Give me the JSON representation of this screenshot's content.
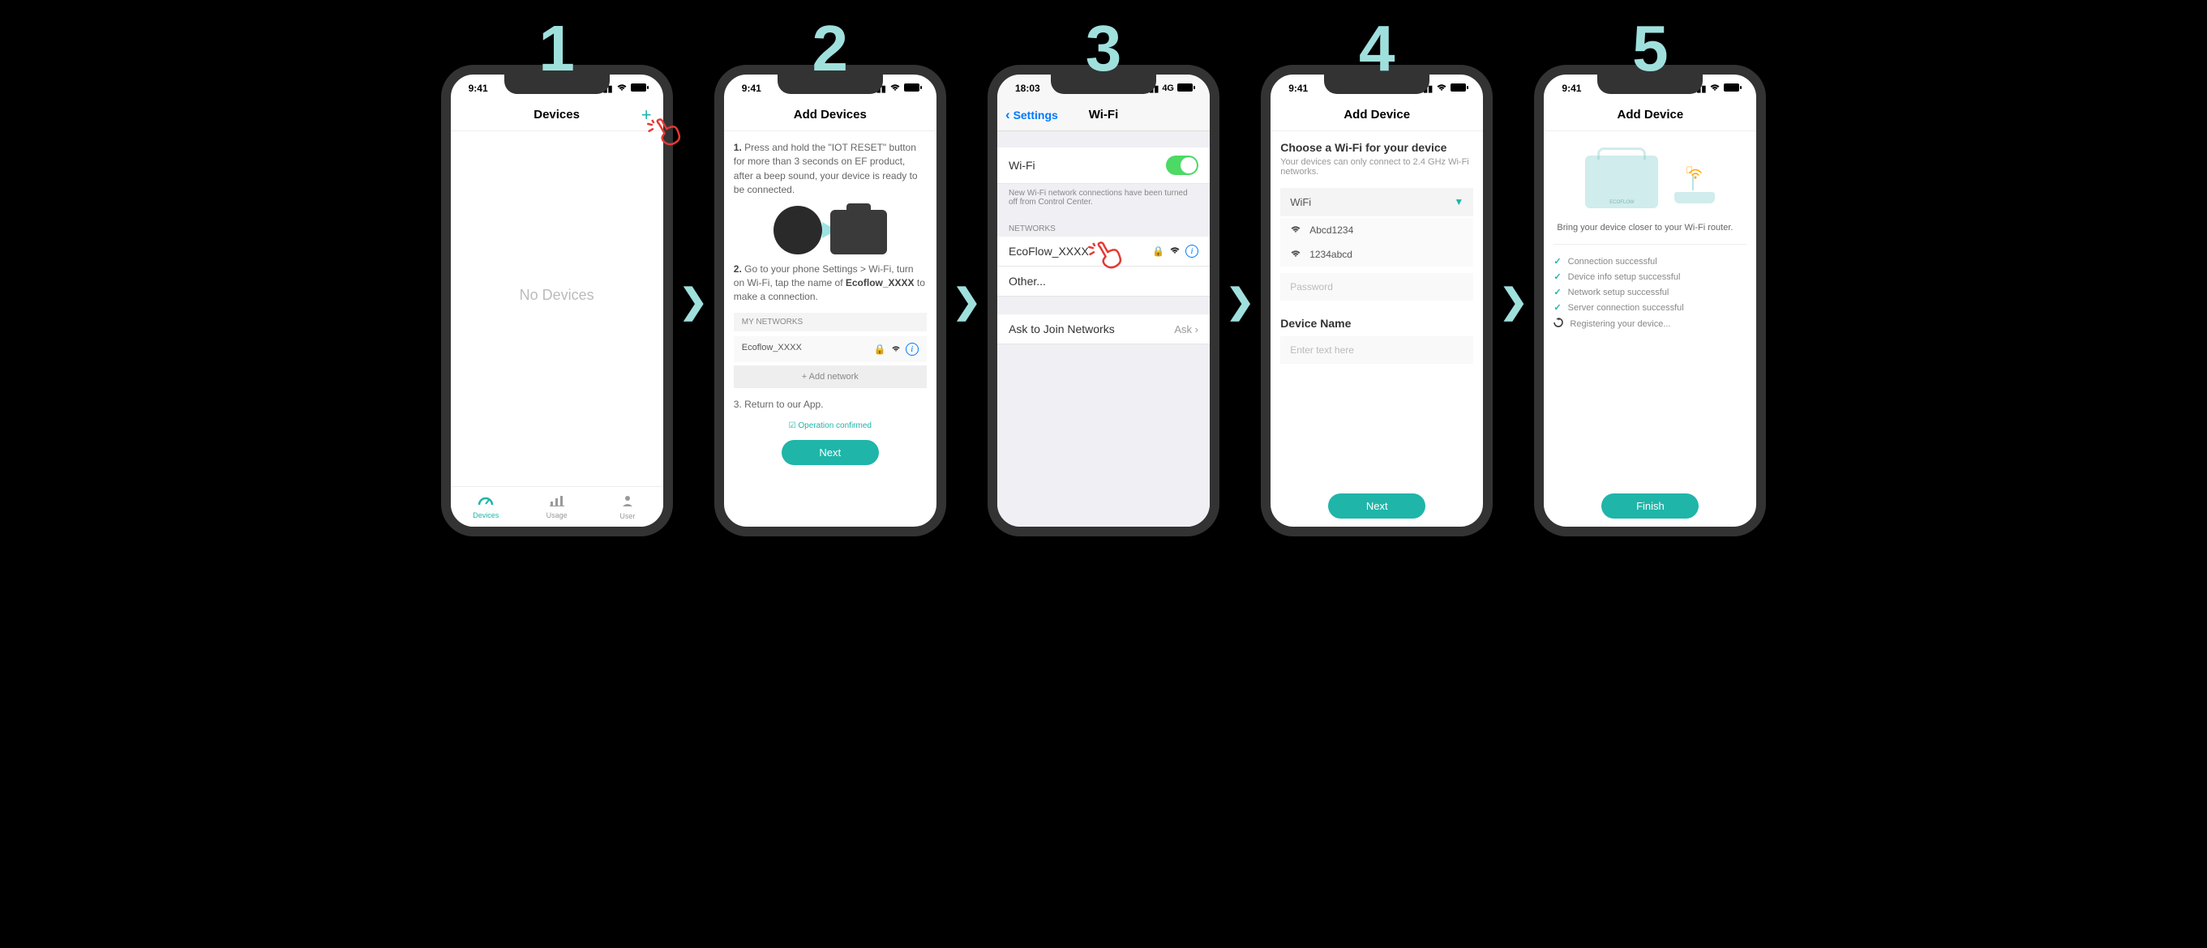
{
  "steps": [
    "1",
    "2",
    "3",
    "4",
    "5"
  ],
  "status_time": "9:41",
  "step1": {
    "title": "Devices",
    "empty": "No Devices",
    "tabs": {
      "devices": "Devices",
      "usage": "Usage",
      "user": "User"
    }
  },
  "step2": {
    "title": "Add Devices",
    "p1_label": "1.",
    "p1": " Press and hold the \"IOT RESET\" button for more than 3 seconds on EF product, after a beep sound, your device is ready to be connected.",
    "p2_label": "2.",
    "p2_a": " Go to your phone Settings > Wi-Fi, turn on Wi-Fi, tap the name of ",
    "p2_bold": "Ecoflow_XXXX",
    "p2_b": " to make a connection.",
    "my_networks": "MY NETWORKS",
    "net_name": "Ecoflow_XXXX",
    "add_network": "+ Add network",
    "p3": "3. Return to our App.",
    "confirm": "Operation confirmed",
    "next": "Next"
  },
  "step3": {
    "time": "18:03",
    "sig": "4G",
    "back": "Settings",
    "title": "Wi-Fi",
    "wifi_label": "Wi-Fi",
    "note": "New Wi-Fi network connections have been turned off from Control Center.",
    "networks": "NETWORKS",
    "ssid": "EcoFlow_XXXX",
    "other": "Other...",
    "ask_label": "Ask to Join Networks",
    "ask_value": "Ask"
  },
  "step4": {
    "title": "Add Device",
    "choose": "Choose a Wi-Fi for your device",
    "sub": "Your devices can only connect to 2.4 GHz Wi-Fi networks.",
    "wifi": "WiFi",
    "opt1": "Abcd1234",
    "opt2": "1234abcd",
    "pwd_placeholder": "Password",
    "device_name_label": "Device Name",
    "name_placeholder": "Enter text here",
    "next": "Next"
  },
  "step5": {
    "title": "Add Device",
    "tip": "Bring your device closer to your Wi-Fi router.",
    "items": [
      "Connection successful",
      "Device info setup successful",
      "Network setup successful",
      "Server connection successful",
      "Registering your device..."
    ],
    "finish": "Finish"
  }
}
